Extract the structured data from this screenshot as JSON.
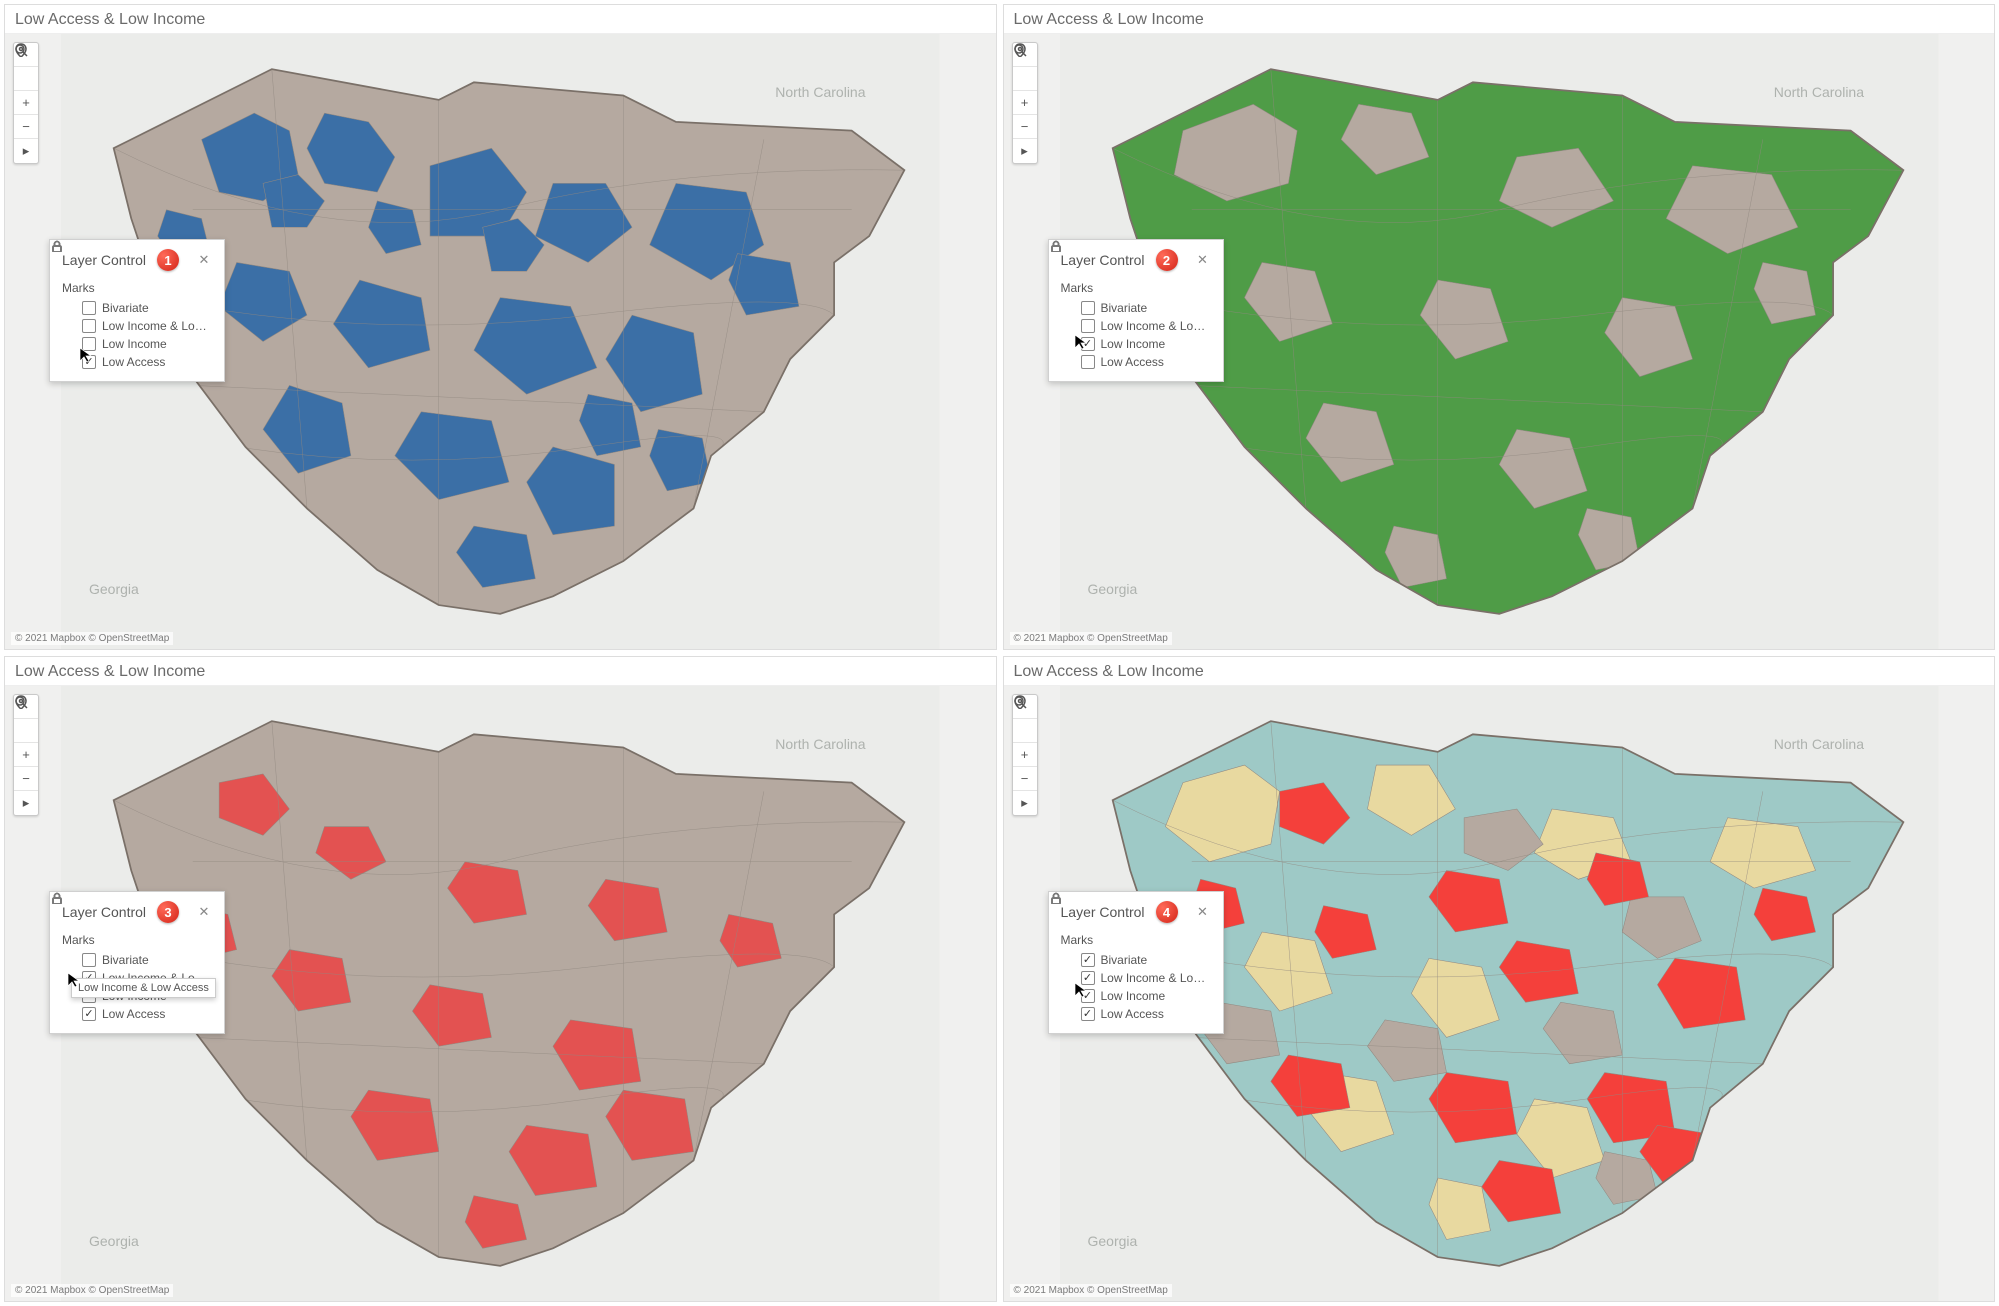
{
  "panels": {
    "p1": {
      "title": "Low Access & Low Income",
      "badge": "1",
      "layer_title": "Layer Control",
      "marks_label": "Marks",
      "items": [
        {
          "label": "Bivariate",
          "checked": false
        },
        {
          "label": "Low Income & Lo…",
          "checked": false
        },
        {
          "label": "Low Income",
          "checked": false
        },
        {
          "label": "Low Access",
          "checked": true
        }
      ]
    },
    "p2": {
      "title": "Low Access & Low Income",
      "badge": "2",
      "layer_title": "Layer Control",
      "marks_label": "Marks",
      "items": [
        {
          "label": "Bivariate",
          "checked": false
        },
        {
          "label": "Low Income & Lo…",
          "checked": false
        },
        {
          "label": "Low Income",
          "checked": true
        },
        {
          "label": "Low Access",
          "checked": false
        }
      ]
    },
    "p3": {
      "title": "Low Access & Low Income",
      "badge": "3",
      "layer_title": "Layer Control",
      "marks_label": "Marks",
      "items": [
        {
          "label": "Bivariate",
          "checked": false
        },
        {
          "label": "Low Income & Lo…",
          "checked": true
        },
        {
          "label": "Low Income",
          "checked": true
        },
        {
          "label": "Low Access",
          "checked": true
        }
      ],
      "tooltip": "Low Income & Low Access"
    },
    "p4": {
      "title": "Low Access & Low Income",
      "badge": "4",
      "layer_title": "Layer Control",
      "marks_label": "Marks",
      "items": [
        {
          "label": "Bivariate",
          "checked": true
        },
        {
          "label": "Low Income & Lo…",
          "checked": true
        },
        {
          "label": "Low Income",
          "checked": true
        },
        {
          "label": "Low Access",
          "checked": true
        }
      ]
    }
  },
  "labels": {
    "nc": "North Carolina",
    "ga": "Georgia"
  },
  "attribution": "© 2021 Mapbox © OpenStreetMap",
  "colors": {
    "base_land": "#b5a9a0",
    "bg_water": "#ebecea",
    "blue": "#3b6fa6",
    "green": "#4f9c47",
    "red": "#e35251",
    "biv_teal": "#9ec9c6",
    "biv_cream": "#e8d9a0",
    "biv_red": "#f4403b",
    "biv_gray": "#b5a9a0"
  }
}
